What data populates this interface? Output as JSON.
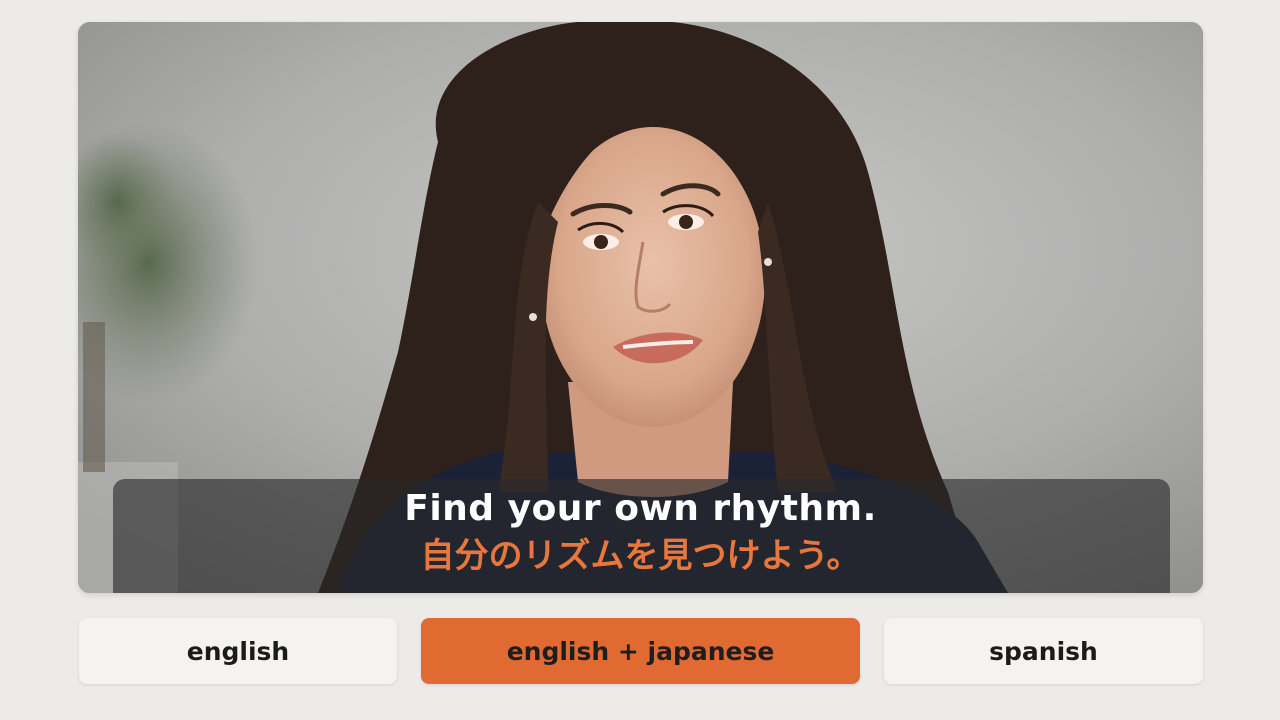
{
  "video": {
    "subtitle_primary": "Find your own rhythm.",
    "subtitle_secondary": "自分のリズムを見つけよう。",
    "primary_color": "#FFFFFF",
    "secondary_color": "#E8773E"
  },
  "language_options": [
    {
      "label": "english",
      "selected": false
    },
    {
      "label": "english + japanese",
      "selected": true
    },
    {
      "label": "spanish",
      "selected": false
    }
  ],
  "colors": {
    "background": "#ECEBE8",
    "button": "#F5F3EF",
    "button_selected": "#E06A32"
  }
}
